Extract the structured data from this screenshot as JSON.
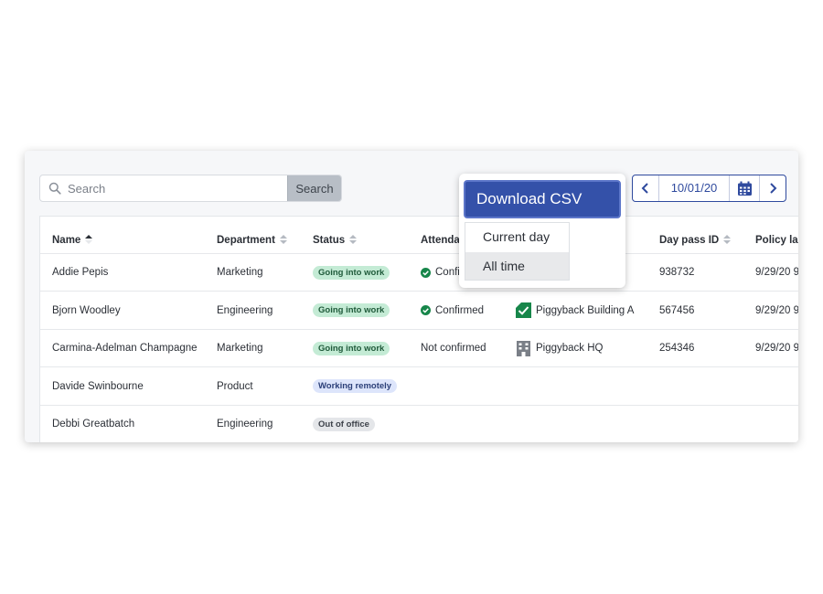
{
  "search": {
    "placeholder": "Search",
    "button_label": "Search"
  },
  "date_nav": {
    "date": "10/01/20"
  },
  "download": {
    "button_label": "Download CSV",
    "options": [
      "Current day",
      "All time"
    ],
    "selected": "All time"
  },
  "table": {
    "columns": [
      "Name",
      "Department",
      "Status",
      "Attenda",
      "",
      "Day pass ID",
      "Policy las"
    ],
    "rows": [
      {
        "name": "Addie Pepis",
        "department": "Marketing",
        "status": "Going into work",
        "status_type": "green",
        "attendance": "Confi",
        "attendance_confirmed": true,
        "location": "",
        "location_icon": "",
        "day_pass_id": "938732",
        "policy": "9/29/20 9"
      },
      {
        "name": "Bjorn Woodley",
        "department": "Engineering",
        "status": "Going into work",
        "status_type": "green",
        "attendance": "Confirmed",
        "attendance_confirmed": true,
        "location": "Piggyback Building A",
        "location_icon": "check-square-icon",
        "day_pass_id": "567456",
        "policy": "9/29/20 9"
      },
      {
        "name": "Carmina-Adelman Champagne",
        "department": "Marketing",
        "status": "Going into work",
        "status_type": "green",
        "attendance": "Not confirmed",
        "attendance_confirmed": false,
        "location": "Piggyback HQ",
        "location_icon": "building-icon",
        "day_pass_id": "254346",
        "policy": "9/29/20 9"
      },
      {
        "name": "Davide Swinbourne",
        "department": "Product",
        "status": "Working remotely",
        "status_type": "blue",
        "attendance": "",
        "attendance_confirmed": false,
        "location": "",
        "location_icon": "",
        "day_pass_id": "",
        "policy": ""
      },
      {
        "name": "Debbi Greatbatch",
        "department": "Engineering",
        "status": "Out of office",
        "status_type": "gray",
        "attendance": "",
        "attendance_confirmed": false,
        "location": "",
        "location_icon": "",
        "day_pass_id": "",
        "policy": ""
      }
    ]
  },
  "colors": {
    "primary": "#3451a9",
    "confirmed": "#17864a",
    "badge_green": "#c4ebd5",
    "badge_blue": "#dde5fb",
    "badge_gray": "#e4e6e9"
  }
}
